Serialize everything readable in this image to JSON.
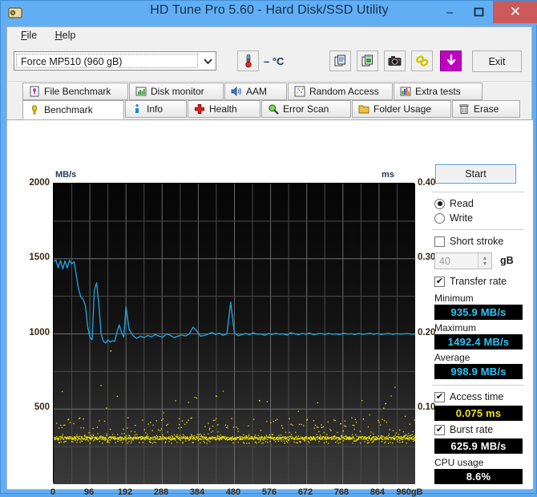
{
  "window": {
    "title": "HD Tune Pro 5.60 - Hard Disk/SSD Utility",
    "icon": "hdtune-app-icon",
    "minimize": "–",
    "maximize": "☐",
    "close": "✕",
    "accent_blue": "#62aef5",
    "close_red": "#cd5a5a"
  },
  "menu": {
    "items": [
      {
        "label": "File",
        "accel": "F"
      },
      {
        "label": "Help",
        "accel": "H"
      }
    ]
  },
  "toolbar": {
    "drive": {
      "selected": "Force MP510 (960 gB)",
      "arrow": "▼"
    },
    "temperature": "– °C",
    "thermometer_icon": "thermometer-icon",
    "buttons": [
      {
        "name": "copy-text-icon",
        "label": ""
      },
      {
        "name": "copy-image-icon",
        "label": ""
      },
      {
        "name": "screenshot-camera-icon",
        "label": ""
      },
      {
        "name": "chain-link-icon",
        "label": ""
      },
      {
        "name": "download-arrow-icon",
        "label": ""
      }
    ],
    "exit_label": "Exit",
    "download_button_color": "#c000c0"
  },
  "tabs_row1": [
    {
      "label": "File Benchmark",
      "icon": "file-benchmark-icon",
      "active": false
    },
    {
      "label": "Disk monitor",
      "icon": "disk-monitor-icon",
      "active": false
    },
    {
      "label": "AAM",
      "icon": "speaker-icon",
      "active": false
    },
    {
      "label": "Random Access",
      "icon": "random-access-icon",
      "active": false
    },
    {
      "label": "Extra tests",
      "icon": "extra-tests-icon",
      "active": false
    }
  ],
  "tabs_row2": [
    {
      "label": "Benchmark",
      "icon": "benchmark-bulb-icon",
      "active": true
    },
    {
      "label": "Info",
      "icon": "info-icon",
      "active": false
    },
    {
      "label": "Health",
      "icon": "health-cross-icon",
      "active": false
    },
    {
      "label": "Error Scan",
      "icon": "magnifier-icon",
      "active": false
    },
    {
      "label": "Folder Usage",
      "icon": "folder-icon",
      "active": false
    },
    {
      "label": "Erase",
      "icon": "trash-icon",
      "active": false
    }
  ],
  "side": {
    "start_label": "Start",
    "mode_read": "Read",
    "mode_write": "Write",
    "mode_selected": "Read",
    "short_stroke_label": "Short stroke",
    "short_stroke_checked": false,
    "short_stroke_value": "40",
    "short_stroke_unit": "gB",
    "transfer_rate_label": "Transfer rate",
    "transfer_rate_checked": true,
    "minimum_label": "Minimum",
    "minimum_value": "935.9 MB/s",
    "maximum_label": "Maximum",
    "maximum_value": "1492.4 MB/s",
    "average_label": "Average",
    "average_value": "998.9 MB/s",
    "access_time_label": "Access time",
    "access_time_checked": true,
    "access_time_value": "0.075 ms",
    "burst_rate_label": "Burst rate",
    "burst_rate_checked": true,
    "burst_rate_value": "625.9 MB/s",
    "cpu_usage_label": "CPU usage",
    "cpu_usage_value": "8.6%"
  },
  "chart_data": {
    "type": "line",
    "title": "",
    "xlabel": "",
    "ylabel": "MB/s",
    "y2label": "ms",
    "xlim": [
      0,
      960
    ],
    "ylim": [
      0,
      2000
    ],
    "y2lim": [
      0.0,
      0.4
    ],
    "grid": true,
    "x_ticks": [
      0,
      96,
      192,
      288,
      384,
      480,
      576,
      672,
      768,
      864,
      960
    ],
    "x_tick_labels": [
      "0",
      "96",
      "192",
      "288",
      "384",
      "480",
      "576",
      "672",
      "768",
      "864",
      "960gB"
    ],
    "y_ticks": [
      500,
      1000,
      1500,
      2000
    ],
    "y_tick_labels": [
      "500",
      "1000",
      "1500",
      "2000"
    ],
    "y2_ticks": [
      0.1,
      0.2,
      0.3,
      0.4
    ],
    "y2_tick_labels": [
      "0.10",
      "0.20",
      "0.30",
      "0.40"
    ],
    "series": [
      {
        "name": "Transfer rate",
        "color": "#1f9fd8",
        "axis": "left",
        "unit": "MB/s",
        "x": [
          0,
          6,
          12,
          18,
          24,
          30,
          36,
          42,
          48,
          54,
          60,
          66,
          72,
          78,
          84,
          90,
          96,
          102,
          108,
          114,
          120,
          126,
          132,
          138,
          144,
          150,
          156,
          162,
          168,
          174,
          180,
          186,
          192,
          200,
          210,
          220,
          230,
          240,
          250,
          260,
          270,
          280,
          290,
          300,
          310,
          320,
          330,
          340,
          350,
          360,
          370,
          380,
          390,
          400,
          410,
          420,
          430,
          440,
          450,
          460,
          470,
          480,
          490,
          500,
          510,
          520,
          530,
          540,
          550,
          560,
          570,
          580,
          590,
          600,
          610,
          620,
          630,
          640,
          650,
          660,
          670,
          680,
          690,
          700,
          710,
          720,
          730,
          740,
          750,
          760,
          770,
          780,
          790,
          800,
          810,
          820,
          830,
          840,
          850,
          860,
          870,
          880,
          890,
          900,
          910,
          920,
          930,
          940,
          950,
          960
        ],
        "y": [
          1480,
          1492,
          1440,
          1488,
          1432,
          1486,
          1438,
          1490,
          1465,
          1480,
          1390,
          1300,
          1245,
          1232,
          1190,
          1050,
          980,
          960,
          1290,
          1340,
          1190,
          1000,
          950,
          940,
          960,
          945,
          955,
          950,
          1010,
          1060,
          1010,
          980,
          1180,
          1030,
          990,
          970,
          985,
          975,
          990,
          980,
          995,
          985,
          978,
          1000,
          990,
          975,
          985,
          992,
          986,
          1000,
          1045,
          1020,
          985,
          990,
          998,
          1010,
          995,
          1005,
          990,
          1000,
          1210,
          1005,
          988,
          996,
          1002,
          994,
          1008,
          998,
          1000,
          990,
          1002,
          996,
          1005,
          997,
          1000,
          992,
          1008,
          1000,
          995,
          1003,
          998,
          1006,
          994,
          1000,
          1002,
          996,
          1004,
          998,
          1000,
          995,
          1005,
          999,
          1001,
          996,
          1003,
          997,
          1000,
          1004,
          998,
          1002,
          996,
          1000,
          1003,
          997,
          1001,
          999,
          1000,
          1002,
          998,
          1000
        ]
      },
      {
        "name": "Access time",
        "color": "#f2e300",
        "axis": "right",
        "unit": "ms",
        "style": "scatter",
        "baseline": 0.06,
        "spread_low": 0.055,
        "spread_high": 0.09,
        "outlier_high": 0.13
      }
    ]
  }
}
